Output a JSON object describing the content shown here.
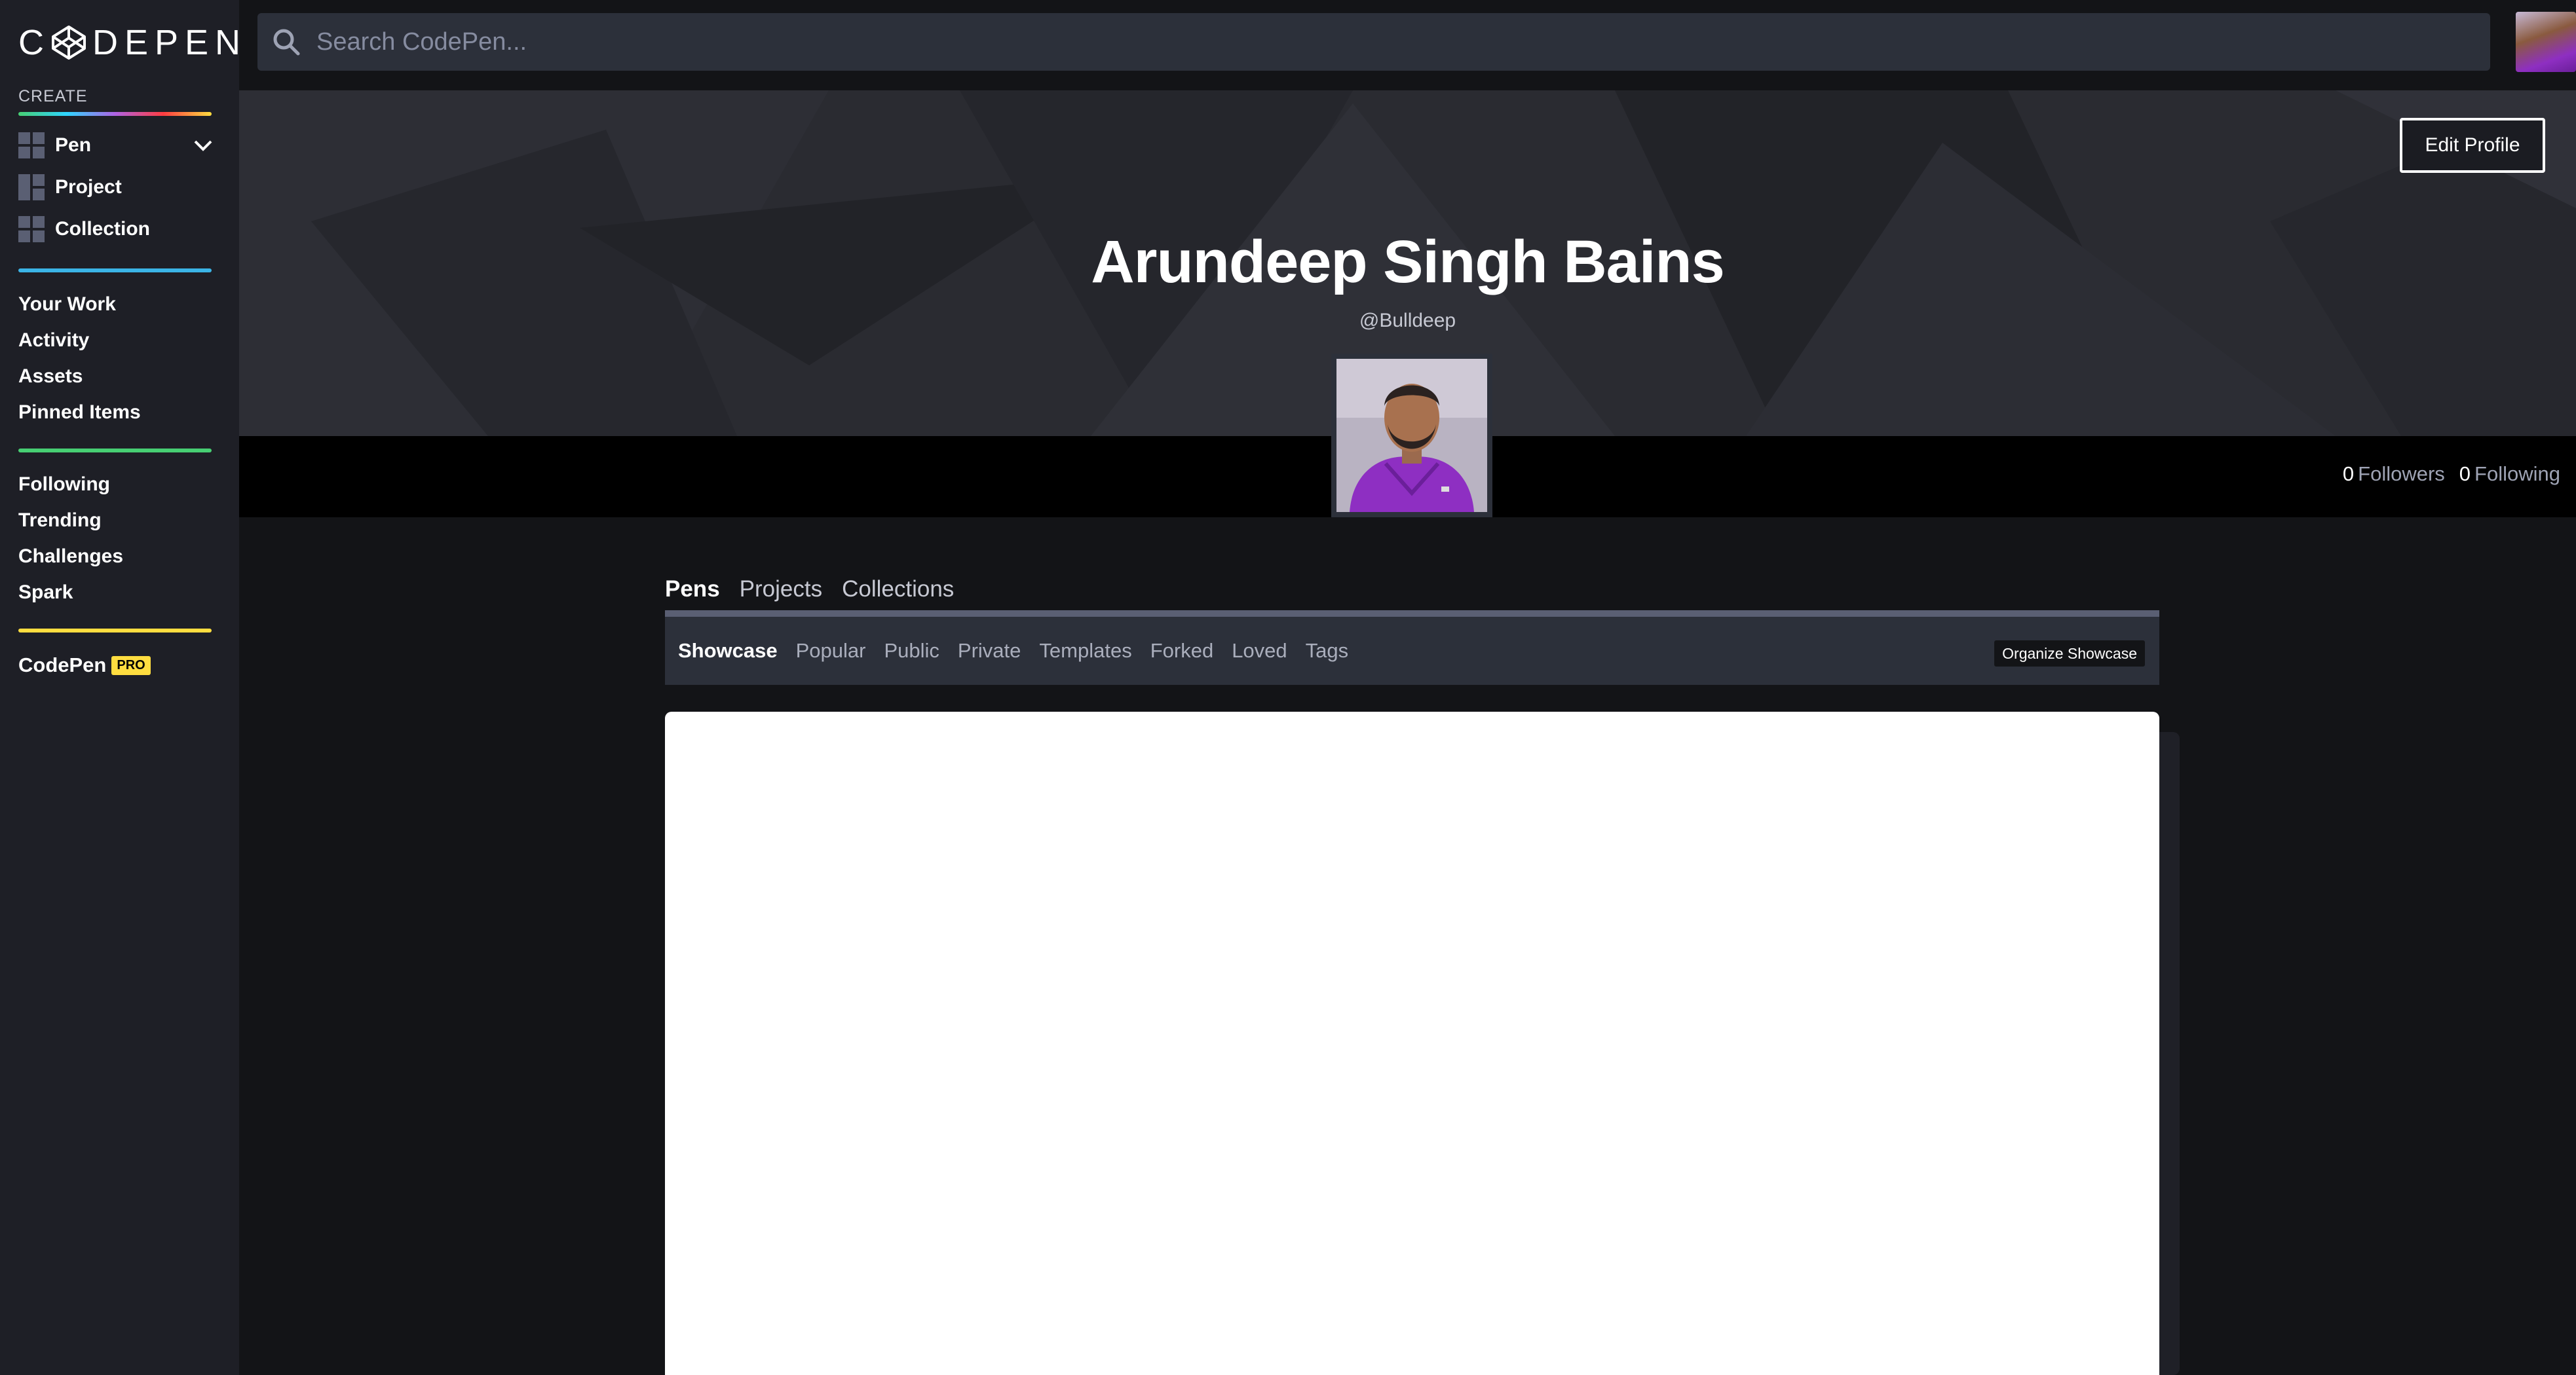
{
  "brand": {
    "logo_text": "CODEPEN"
  },
  "sidebar": {
    "create_label": "CREATE",
    "create_items": [
      {
        "label": "Pen",
        "icon": "pen-grid-icon"
      },
      {
        "label": "Project",
        "icon": "project-layout-icon"
      },
      {
        "label": "Collection",
        "icon": "collection-grid-icon"
      }
    ],
    "nav_primary": [
      "Your Work",
      "Activity",
      "Assets",
      "Pinned Items"
    ],
    "nav_secondary": [
      "Following",
      "Trending",
      "Challenges",
      "Spark"
    ],
    "pro": {
      "label": "CodePen",
      "badge": "PRO"
    }
  },
  "search": {
    "placeholder": "Search CodePen..."
  },
  "profile": {
    "name": "Arundeep Singh Bains",
    "handle": "@Bulldeep",
    "edit_label": "Edit Profile",
    "followers_count": "0",
    "followers_label": "Followers",
    "following_count": "0",
    "following_label": "Following"
  },
  "tabs": [
    "Pens",
    "Projects",
    "Collections"
  ],
  "subnav": {
    "items": [
      "Showcase",
      "Popular",
      "Public",
      "Private",
      "Templates",
      "Forked",
      "Loved",
      "Tags"
    ],
    "organize_label": "Organize Showcase"
  },
  "colors": {
    "sidebar_bg": "#1e1f26",
    "page_bg": "#131417",
    "hero_bg": "#2a2b31",
    "pro_badge": "#ffdd40",
    "accent_green": "#47cf73",
    "accent_blue": "#3bb4e6"
  }
}
